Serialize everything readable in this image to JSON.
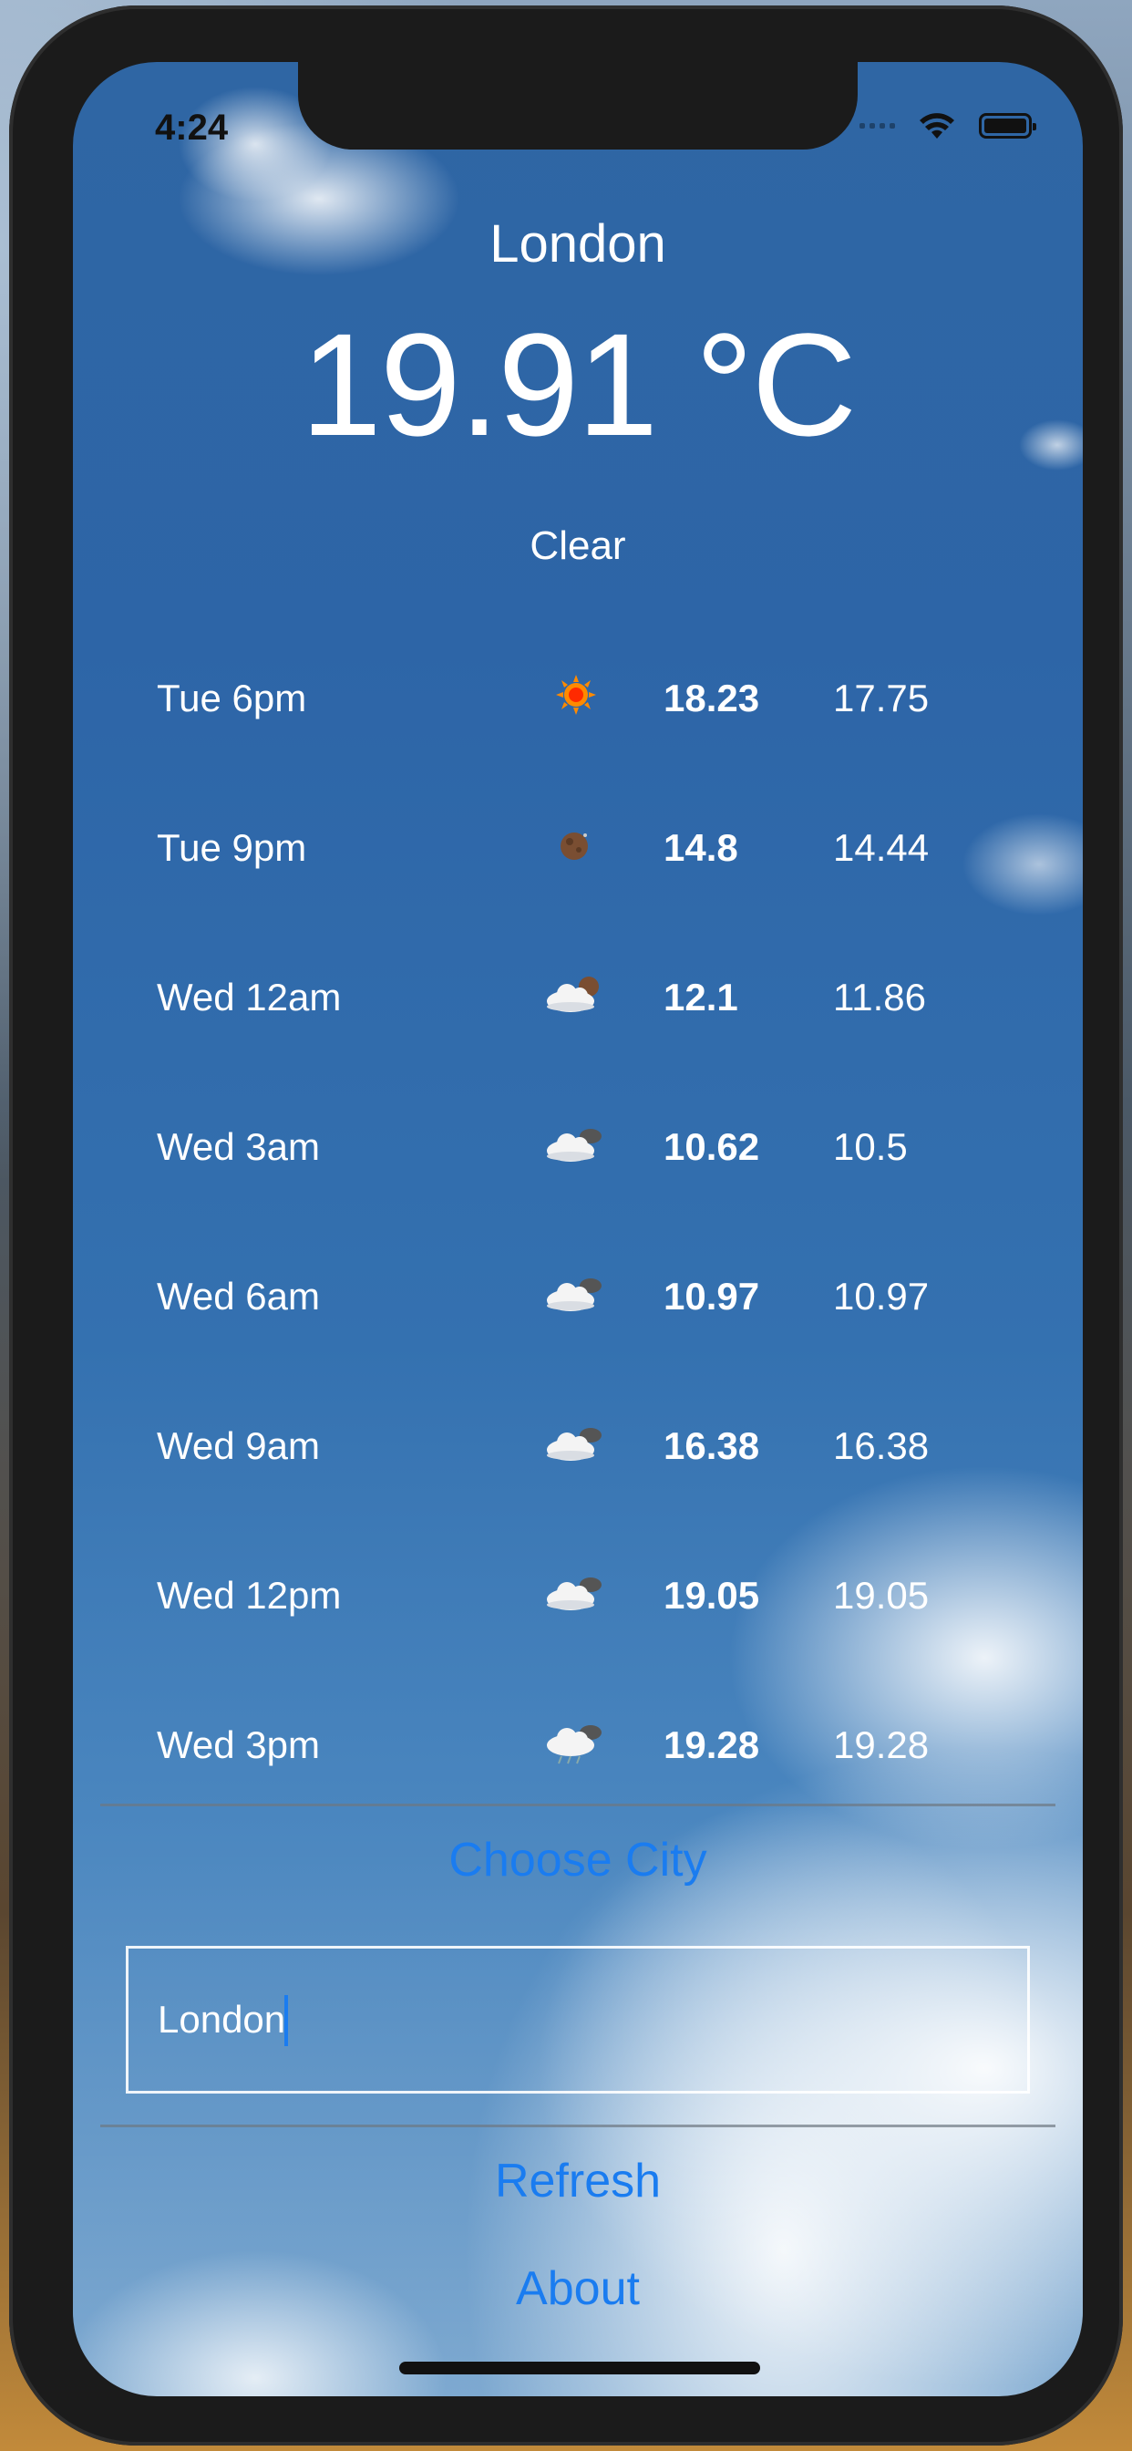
{
  "status_bar": {
    "time": "4:24"
  },
  "weather": {
    "city": "London",
    "temperature": "19.91 °C",
    "condition": "Clear"
  },
  "forecast": [
    {
      "time": "Tue 6pm",
      "icon": "sun-icon",
      "high": "18.23",
      "low": "17.75"
    },
    {
      "time": "Tue 9pm",
      "icon": "moon-icon",
      "high": "14.8",
      "low": "14.44"
    },
    {
      "time": "Wed 12am",
      "icon": "cloud-moon-icon",
      "high": "12.1",
      "low": "11.86"
    },
    {
      "time": "Wed 3am",
      "icon": "cloud-icon",
      "high": "10.62",
      "low": "10.5"
    },
    {
      "time": "Wed 6am",
      "icon": "cloud-icon",
      "high": "10.97",
      "low": "10.97"
    },
    {
      "time": "Wed 9am",
      "icon": "cloud-icon",
      "high": "16.38",
      "low": "16.38"
    },
    {
      "time": "Wed 12pm",
      "icon": "cloud-icon",
      "high": "19.05",
      "low": "19.05"
    },
    {
      "time": "Wed 3pm",
      "icon": "rain-cloud-icon",
      "high": "19.28",
      "low": "19.28"
    }
  ],
  "controls": {
    "choose_city_label": "Choose City",
    "city_input_value": "London",
    "refresh_label": "Refresh",
    "about_label": "About"
  },
  "colors": {
    "link": "#1a7cf0",
    "text": "#ffffff"
  }
}
